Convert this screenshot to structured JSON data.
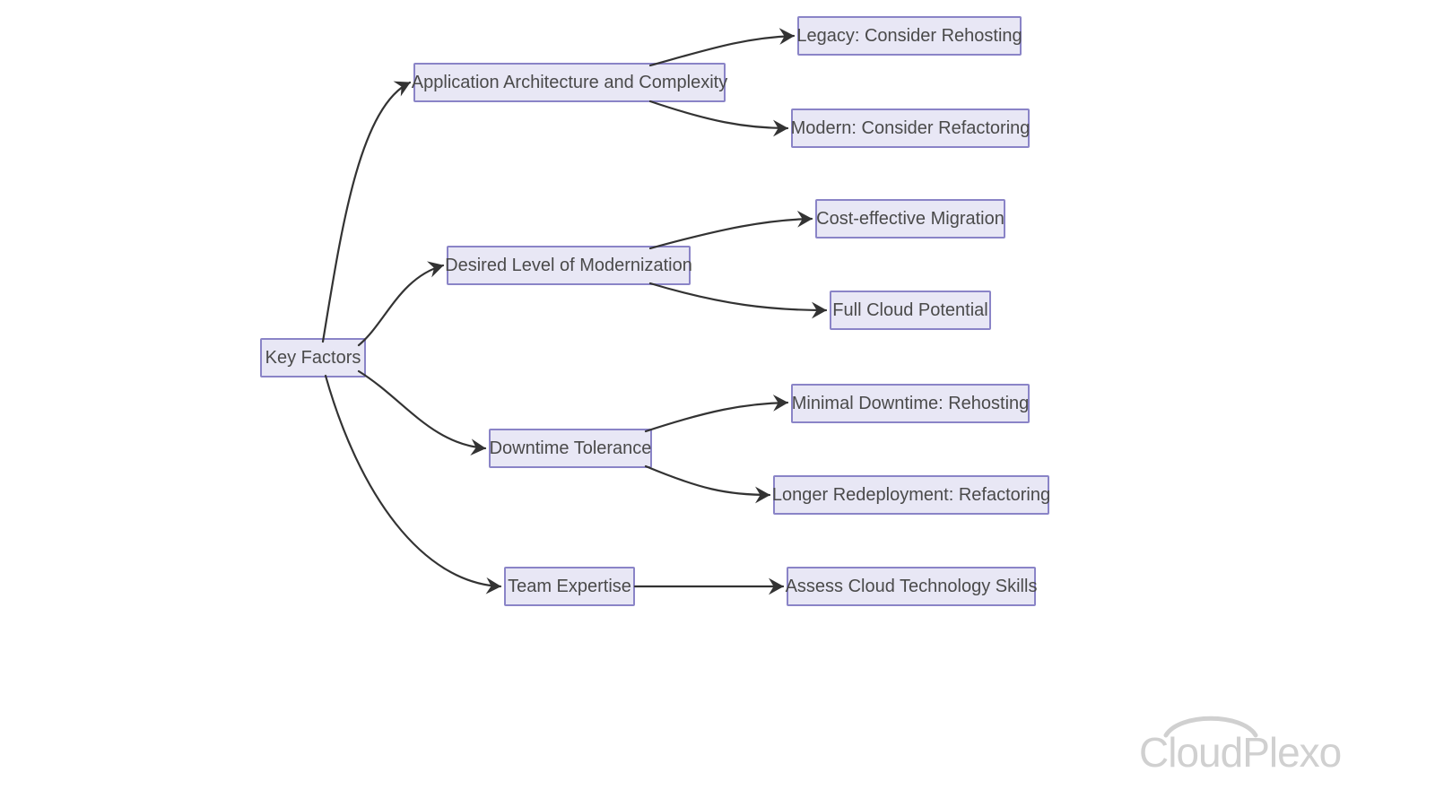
{
  "root": {
    "label": "Key Factors"
  },
  "branches": [
    {
      "id": "arch",
      "label": "Application Architecture and Complexity",
      "children": [
        {
          "id": "legacy",
          "label": "Legacy: Consider Rehosting"
        },
        {
          "id": "modern",
          "label": "Modern: Consider Refactoring"
        }
      ]
    },
    {
      "id": "modern-level",
      "label": "Desired Level of Modernization",
      "children": [
        {
          "id": "cost",
          "label": "Cost-effective Migration"
        },
        {
          "id": "fullcloud",
          "label": "Full Cloud Potential"
        }
      ]
    },
    {
      "id": "downtime",
      "label": "Downtime Tolerance",
      "children": [
        {
          "id": "minimal",
          "label": "Minimal Downtime: Rehosting"
        },
        {
          "id": "longer",
          "label": "Longer Redeployment: Refactoring"
        }
      ]
    },
    {
      "id": "team",
      "label": "Team Expertise",
      "children": [
        {
          "id": "assess",
          "label": "Assess Cloud Technology Skills"
        }
      ]
    }
  ],
  "logo": "CloudPlexo"
}
